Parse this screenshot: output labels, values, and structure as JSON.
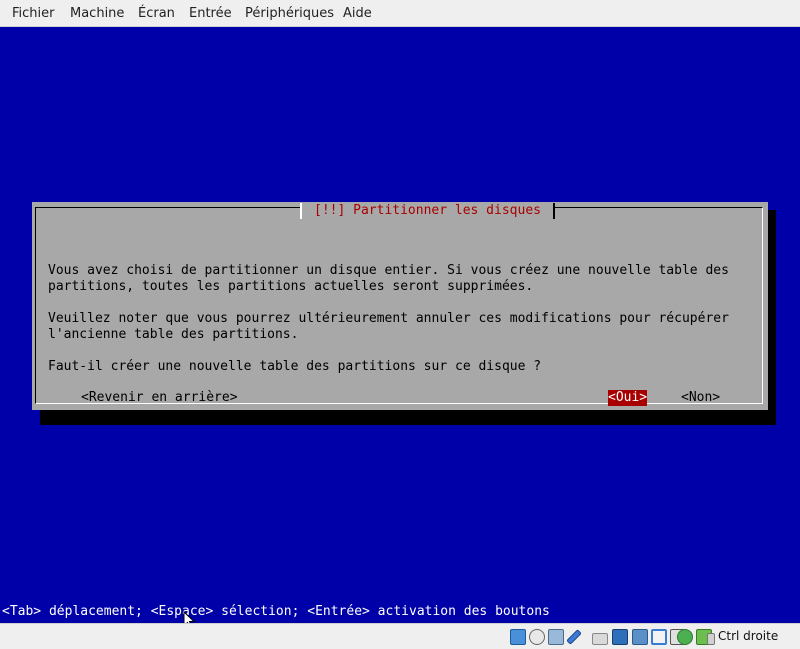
{
  "menubar": {
    "items": [
      "Fichier",
      "Machine",
      "Écran",
      "Entrée",
      "Périphériques",
      "Aide"
    ]
  },
  "dialog": {
    "title": "[!!] Partitionner les disques",
    "paragraph1": "Vous avez choisi de partitionner un disque entier. Si vous créez une nouvelle table des\npartitions, toutes les partitions actuelles seront supprimées.",
    "paragraph2": "Veuillez noter que vous pourrez ultérieurement annuler ces modifications pour récupérer\nl'ancienne table des partitions.",
    "question": "Faut-il créer une nouvelle table des partitions sur ce disque ?",
    "buttons": {
      "back": "<Revenir en arrière>",
      "yes": "<Oui>",
      "no": "<Non>"
    },
    "selected_button": "yes"
  },
  "help_line": "<Tab> déplacement; <Espace> sélection; <Entrée> activation des boutons",
  "statusbar": {
    "host_key_label": "Ctrl droite",
    "icons": [
      "hard-disk-icon",
      "optical-drive-icon",
      "audio-icon",
      "usb-icon",
      "shared-folders-icon",
      "display-icon",
      "video-capture-icon",
      "network-icon",
      "cpu-icon",
      "recording-icon",
      "mouse-integration-icon",
      "keyboard-capture-icon"
    ]
  },
  "colors": {
    "screen_bg": "#0000a8",
    "dialog_bg": "#a8a8a8",
    "title_fg": "#a80000",
    "selected_button_bg": "#a80000"
  }
}
